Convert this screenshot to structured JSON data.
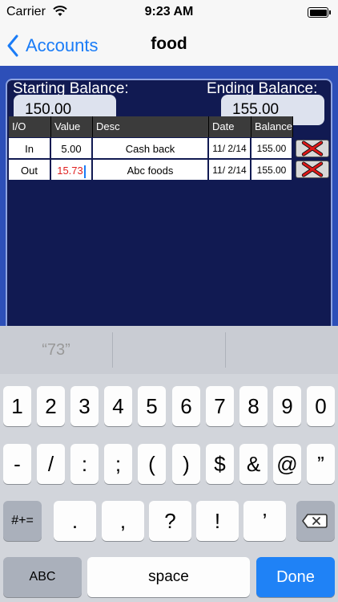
{
  "status": {
    "carrier": "Carrier",
    "time": "9:23 AM"
  },
  "nav": {
    "back_label": "Accounts",
    "title": "food"
  },
  "balances": {
    "starting_label": "Starting Balance:",
    "starting_value": "150.00",
    "ending_label": "Ending Balance:",
    "ending_value": "155.00"
  },
  "table": {
    "headers": [
      "I/O",
      "Value",
      "Desc",
      "Date",
      "Balance"
    ],
    "rows": [
      {
        "io": "In",
        "value": "5.00",
        "desc": "Cash back",
        "date": "11/ 2/14",
        "balance": "155.00"
      },
      {
        "io": "Out",
        "value": "15.73",
        "desc": "Abc foods",
        "date": "11/ 2/14",
        "balance": "155.00"
      }
    ]
  },
  "keyboard": {
    "suggestion": "“73”",
    "row1": [
      "1",
      "2",
      "3",
      "4",
      "5",
      "6",
      "7",
      "8",
      "9",
      "0"
    ],
    "row2": [
      "-",
      "/",
      ":",
      ";",
      "(",
      ")",
      "$",
      "&",
      "@",
      "”"
    ],
    "row3": [
      ".",
      ",",
      "?",
      "!",
      "’"
    ],
    "symbols_label": "#+=",
    "abc_label": "ABC",
    "space_label": "space",
    "done_label": "Done"
  },
  "colors": {
    "nav_blue": "#1a7cf7",
    "panel_bg": "#111a52",
    "content_bg": "#2d4fb8",
    "value_red": "#e02020",
    "done_blue": "#1f82f6"
  }
}
